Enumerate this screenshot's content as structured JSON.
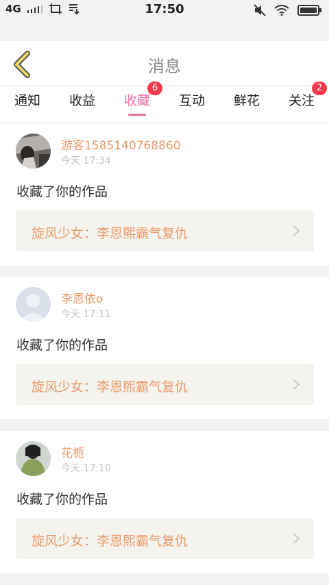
{
  "status_bar": {
    "network": "4G",
    "time": "17:50",
    "left_icons": [
      "signal-icon",
      "screenshot-icon",
      "download-icon"
    ],
    "right_icons": [
      "mute-icon",
      "wifi-icon",
      "battery-icon"
    ]
  },
  "header": {
    "title": "消息",
    "back_icon": "chevron-left-icon",
    "accent_color": "#e96fa2"
  },
  "tabs": [
    {
      "label": "通知",
      "active": false,
      "badge": ""
    },
    {
      "label": "收益",
      "active": false,
      "badge": ""
    },
    {
      "label": "收藏",
      "active": true,
      "badge": "6"
    },
    {
      "label": "互动",
      "active": false,
      "badge": ""
    },
    {
      "label": "鲜花",
      "active": false,
      "badge": ""
    },
    {
      "label": "关注",
      "active": false,
      "badge": "2"
    }
  ],
  "messages": [
    {
      "username": "游客1585140768860",
      "time": "今天 17:34",
      "action": "收藏了你的作品",
      "work_title": "旋风少女：李恩熙霸气复仇",
      "avatar": "photo-avatar"
    },
    {
      "username": "李恩依o",
      "time": "今天 17:11",
      "action": "收藏了你的作品",
      "work_title": "旋风少女：李恩熙霸气复仇",
      "avatar": "default-avatar"
    },
    {
      "username": "花栀",
      "time": "今天 17:10",
      "action": "收藏了你的作品",
      "work_title": "旋风少女：李恩熙霸气复仇",
      "avatar": "photo-avatar"
    }
  ],
  "colors": {
    "username": "#ea9a6a",
    "badge": "#f4394a",
    "link_background": "#f4f3ee"
  }
}
